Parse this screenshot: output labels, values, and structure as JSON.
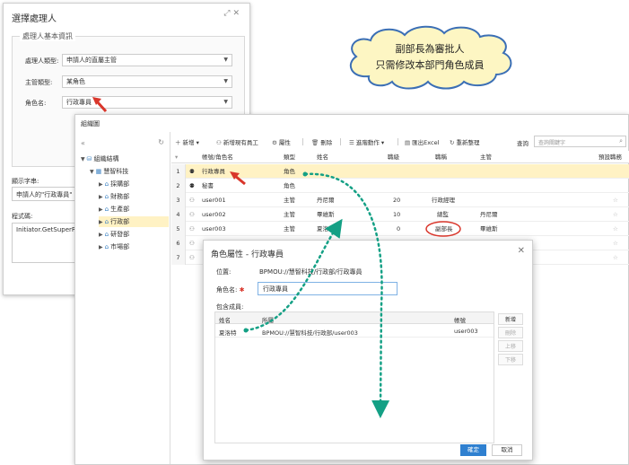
{
  "handler_dialog": {
    "title": "選擇處理人",
    "section_title": "處理人基本資訊",
    "fields": [
      {
        "label": "處理人類型:",
        "value": "申請人的直屬主管"
      },
      {
        "label": "主管類型:",
        "value": "某角色"
      },
      {
        "label": "角色名:",
        "value": "行政專員"
      }
    ],
    "display_label": "顯示字串:",
    "display_value": "申請人的\"行政專員\"",
    "code_label": "程式碼:",
    "code_value": "Initiator.GetSuperRo"
  },
  "callout": {
    "line1": "副部長為審批人",
    "line2": "只需修改本部門角色成員"
  },
  "org_window": {
    "title": "組織圖",
    "tree": [
      {
        "label": "組織結構",
        "level": 0,
        "expand": "▼"
      },
      {
        "label": "慧智科技",
        "level": 1,
        "expand": "▼"
      },
      {
        "label": "採購部",
        "level": 2,
        "expand": "▶"
      },
      {
        "label": "財務部",
        "level": 2,
        "expand": "▶"
      },
      {
        "label": "生產部",
        "level": 2,
        "expand": "▶"
      },
      {
        "label": "行政部",
        "level": 2,
        "expand": "▶",
        "selected": true
      },
      {
        "label": "研發部",
        "level": 2,
        "expand": "▶"
      },
      {
        "label": "市場部",
        "level": 2,
        "expand": "▶"
      }
    ],
    "toolbar": {
      "add": "新增",
      "add_existing": "新增現有員工",
      "property": "屬性",
      "delete": "刪除",
      "advanced": "進階動作",
      "export": "匯出Excel",
      "reorder": "重新整理",
      "search_label": "查詢",
      "search_placeholder": "查詢關鍵字"
    },
    "columns": [
      "帳號/角色名",
      "類型",
      "姓名",
      "職級",
      "職稱",
      "主管",
      "預設職務"
    ],
    "rows": [
      {
        "n": "1",
        "account": "行政專員",
        "type": "角色",
        "name": "",
        "level": "",
        "title": "",
        "boss": "",
        "role": true,
        "hl": true
      },
      {
        "n": "2",
        "account": "秘書",
        "type": "角色",
        "name": "",
        "level": "",
        "title": "",
        "boss": "",
        "role": true
      },
      {
        "n": "3",
        "account": "user001",
        "type": "主管",
        "name": "丹尼爾",
        "level": "20",
        "title": "行政經理",
        "boss": ""
      },
      {
        "n": "4",
        "account": "user002",
        "type": "主管",
        "name": "畢維斯",
        "level": "10",
        "title": "總監",
        "boss": "丹尼爾"
      },
      {
        "n": "5",
        "account": "user003",
        "type": "主管",
        "name": "夏洛特",
        "level": "0",
        "title": "副部長",
        "boss": "畢維斯"
      },
      {
        "n": "6",
        "account": "",
        "type": "",
        "name": "",
        "level": "",
        "title": "",
        "boss": ""
      },
      {
        "n": "7",
        "account": "",
        "type": "",
        "name": "",
        "level": "",
        "title": "",
        "boss": ""
      }
    ]
  },
  "role_dialog": {
    "title": "角色屬性 - 行政專員",
    "location_label": "位置:",
    "location_value": "BPMOU://慧智科技/行政部/行政專員",
    "name_label": "角色名:",
    "name_value": "行政專員",
    "members_label": "包含成員:",
    "member_columns": [
      "姓名",
      "所屬",
      "帳號"
    ],
    "members": [
      {
        "name": "夏洛特",
        "belongs": "BPMOU://慧智科技/行政部/user003",
        "account": "user003"
      }
    ],
    "side_buttons": [
      "新增",
      "刪除",
      "上移",
      "下移"
    ],
    "ok": "確定",
    "cancel": "取消"
  },
  "colors": {
    "accent": "#2f80d0",
    "highlight_row": "#fff2c4",
    "arrow_red": "#d9362b",
    "dotted_green": "#14a085",
    "cloud_fill": "#fdf6c3",
    "cloud_stroke": "#3b6fb5"
  }
}
